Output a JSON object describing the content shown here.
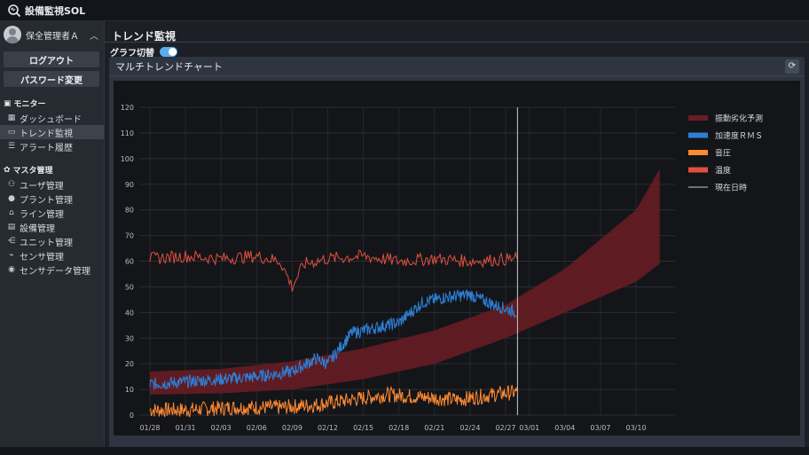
{
  "app": {
    "title": "設備監視SOL"
  },
  "sidebar": {
    "user_name": "保全管理者Ａ",
    "logout_label": "ログアウト",
    "password_label": "パスワード変更",
    "monitor_section": "モニター",
    "monitor_items": [
      {
        "label": "ダッシュボード",
        "icon": "grid-icon"
      },
      {
        "label": "トレンド監視",
        "icon": "monitor-icon",
        "active": true
      },
      {
        "label": "アラート履歴",
        "icon": "list-icon"
      }
    ],
    "master_section": "マスタ管理",
    "master_items": [
      {
        "label": "ユーザ管理",
        "icon": "users-icon"
      },
      {
        "label": "プラント管理",
        "icon": "pin-icon"
      },
      {
        "label": "ライン管理",
        "icon": "line-icon"
      },
      {
        "label": "設備管理",
        "icon": "equipment-icon"
      },
      {
        "label": "ユニット管理",
        "icon": "unit-icon"
      },
      {
        "label": "センサ管理",
        "icon": "sensor-icon"
      },
      {
        "label": "センサデータ管理",
        "icon": "signal-icon"
      }
    ]
  },
  "main": {
    "page_title": "トレンド監視",
    "graph_toggle_label": "グラフ切替",
    "graph_toggle_on": true,
    "panel_title": "マルチトレンドチャート"
  },
  "colors": {
    "prediction": "#6b1c24",
    "rms": "#2d7fd6",
    "sound": "#ff8a33",
    "temperature": "#e0503f",
    "now_line": "#c9ccd1",
    "toggle_on": "#5aaef0"
  },
  "chart_data": {
    "type": "line",
    "x": [
      "01/28",
      "01/31",
      "02/03",
      "02/06",
      "02/09",
      "02/12",
      "02/15",
      "02/18",
      "02/21",
      "02/24",
      "02/27",
      "03/01",
      "03/04",
      "03/07",
      "03/10"
    ],
    "ylim": [
      0,
      120
    ],
    "yticks": [
      0,
      10,
      20,
      30,
      40,
      50,
      60,
      70,
      80,
      90,
      100,
      110,
      120
    ],
    "now_marker": "02/28",
    "legend_position": "right",
    "grid": true,
    "series": [
      {
        "name": "振動劣化予測",
        "kind": "band",
        "x": [
          "01/28",
          "02/03",
          "02/09",
          "02/15",
          "02/21",
          "02/27",
          "03/04",
          "03/10",
          "03/12"
        ],
        "lower": [
          8,
          8.5,
          10,
          14,
          20,
          30,
          40,
          52,
          59
        ],
        "upper": [
          17,
          18,
          21,
          26,
          33,
          43,
          57,
          80,
          96
        ]
      },
      {
        "name": "加速度ＲＭＳ",
        "kind": "line",
        "x": [
          "01/28",
          "01/31",
          "02/03",
          "02/06",
          "02/09",
          "02/11",
          "02/12",
          "02/14",
          "02/16",
          "02/18",
          "02/20",
          "02/22",
          "02/24",
          "02/26",
          "02/28"
        ],
        "values": [
          12,
          13,
          14,
          15,
          17,
          22,
          20,
          32,
          34,
          36,
          44,
          46,
          47,
          43,
          40
        ]
      },
      {
        "name": "音圧",
        "kind": "line",
        "x": [
          "01/28",
          "01/31",
          "02/04",
          "02/08",
          "02/11",
          "02/14",
          "02/17",
          "02/20",
          "02/23",
          "02/26",
          "02/28"
        ],
        "values": [
          2,
          2,
          3,
          3,
          4,
          6,
          8,
          7,
          6,
          8,
          9
        ]
      },
      {
        "name": "温度",
        "kind": "line",
        "x": [
          "01/28",
          "01/31",
          "02/03",
          "02/06",
          "02/08",
          "02/09",
          "02/10",
          "02/12",
          "02/15",
          "02/18",
          "02/21",
          "02/24",
          "02/28"
        ],
        "values": [
          61,
          62,
          61,
          62,
          60,
          50,
          59,
          61,
          62,
          60,
          61,
          60,
          61
        ]
      },
      {
        "name": "現在日時",
        "kind": "marker"
      }
    ]
  }
}
